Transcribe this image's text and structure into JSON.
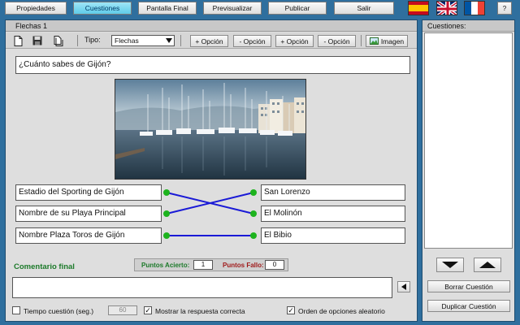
{
  "menu": {
    "propiedades": "Propiedades",
    "cuestiones": "Cuestiones",
    "pantalla_final": "Pantalla Final",
    "previsualizar": "Previsualizar",
    "publicar": "Publicar",
    "salir": "Salir",
    "help": "?"
  },
  "main": {
    "title": "Flechas 1",
    "tipo_label": "Tipo:",
    "tipo_value": "Flechas",
    "add_option_left": "+ Opción",
    "remove_option_left": "- Opción",
    "add_option_right": "+ Opción",
    "remove_option_right": "- Opción",
    "imagen": "Imagen",
    "question": "¿Cuánto sabes de Gijón?",
    "left_options": [
      "Estadio del Sporting de Gijón",
      "Nombre de su Playa Principal",
      "Nombre Plaza Toros de Gijón"
    ],
    "right_options": [
      "San Lorenzo",
      "El Molinón",
      "El Bibio"
    ],
    "comentario_label": "Comentario final",
    "puntos_acierto_label": "Puntos Acierto:",
    "puntos_acierto_value": "1",
    "puntos_fallo_label": "Puntos Fallo:",
    "puntos_fallo_value": "0",
    "tiempo_label": "Tiempo cuestión (seg.)",
    "tiempo_value": "60",
    "mostrar_label": "Mostrar la respuesta correcta",
    "orden_label": "Orden de opciones aleatorio"
  },
  "side": {
    "title": "Cuestiones:",
    "borrar": "Borrar Cuestión",
    "duplicar": "Duplicar Cuestión"
  },
  "colors": {
    "accent": "#2f6f9e",
    "connector": "#1a1ad6",
    "dot": "#1db31d",
    "comentario": "#1c7a2a",
    "fallo": "#a01a1a"
  }
}
